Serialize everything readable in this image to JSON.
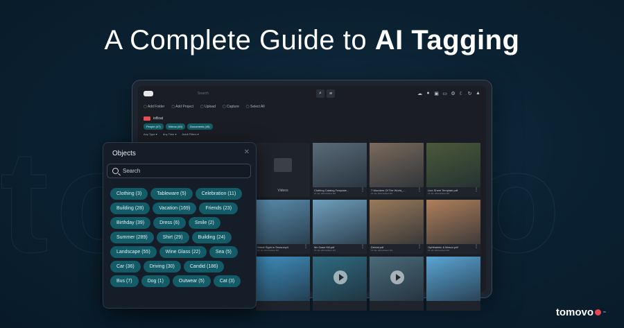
{
  "headline": {
    "regular": "A Complete Guide to ",
    "bold": "AI Tagging"
  },
  "background_word": "tomovo",
  "app": {
    "search_placeholder": "Search",
    "actions": [
      "Add Folder",
      "Add Project",
      "Upload",
      "Capture",
      "Select All"
    ],
    "folder_name": "ioBoat",
    "chips": [
      "People (47)",
      "Videos (45)",
      "Documents (45)"
    ],
    "filters": [
      "Any Type ▾",
      "Any Time ▾",
      "Adult Filters ▾"
    ],
    "tiles": [
      {
        "kind": "folder",
        "caption": "Videos"
      },
      {
        "kind": "image",
        "caption": "Clothing Catalog Template...",
        "sub": "15 Jan 2024 Edited FM",
        "color": "#5a6b78"
      },
      {
        "kind": "image",
        "caption": "7 Wonders Of The World_...",
        "sub": "15 Jan 2024 Edited FM",
        "color": "#7a6a5c"
      },
      {
        "kind": "image",
        "caption": "Line Sheet Template.pdf",
        "sub": "15 Jan 2024 Edited FM",
        "color": "#4a5a3a"
      },
      {
        "kind": "image",
        "caption": "Street Sight in Snow.mp4",
        "sub": "15 Jan 2024 Edited FM",
        "color": "#5b8fb0"
      },
      {
        "kind": "image",
        "caption": "Mc Gase Hill.pdf",
        "sub": "15 Jan 2024 Edited FM",
        "color": "#6fa0bd"
      },
      {
        "kind": "image",
        "caption": "Dental.pdf",
        "sub": "15 Jan 2024 Edited FM",
        "color": "#9a7a5a"
      },
      {
        "kind": "image",
        "caption": "Ophthalmic & Mesco.pdf",
        "sub": "15 Jan 2024 Edited FM",
        "color": "#b0805a"
      },
      {
        "kind": "image",
        "caption": "",
        "sub": "",
        "color": "#3f8fbf"
      },
      {
        "kind": "video",
        "caption": "",
        "sub": "",
        "color": "#2f6a80"
      },
      {
        "kind": "video",
        "caption": "",
        "sub": "",
        "color": "#4a6a7a"
      },
      {
        "kind": "image",
        "caption": "",
        "sub": "",
        "color": "#5aa5d5"
      }
    ]
  },
  "objects_panel": {
    "title": "Objects",
    "search_placeholder": "Search",
    "tags": [
      "Clothing (3)",
      "Tableware (5)",
      "Celebration (11)",
      "Building (28)",
      "Vacation (169)",
      "Friends (23)",
      "Birthday (39)",
      "Dress (6)",
      "Smile (2)",
      "Summer (289)",
      "Shirt (29)",
      "Building (24)",
      "Landscape (55)",
      "Wine Glass (22)",
      "Sea (5)",
      "Car (36)",
      "Driving (30)",
      "Candid (186)",
      "Bus (7)",
      "Dog (1)",
      "Outwear (5)",
      "Cat (3)"
    ]
  },
  "brand": "tomovo",
  "colors": {
    "accent_teal": "#125b67",
    "brand_red": "#e8454f"
  }
}
